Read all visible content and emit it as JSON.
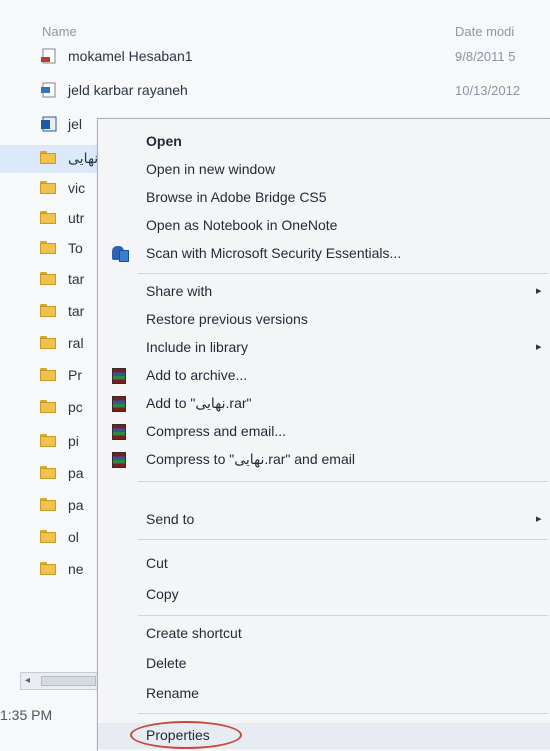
{
  "header": {
    "name_col": "Name",
    "date_col": "Date modi"
  },
  "files": [
    {
      "name": "mokamel Hesaban1",
      "date": "9/8/2011 5",
      "icon": "file-icon"
    },
    {
      "name": "jeld karbar rayaneh",
      "date": "10/13/2012",
      "icon": "file-icon"
    },
    {
      "name": "jel",
      "date": "",
      "icon": "publisher-file-icon"
    },
    {
      "name": "نهایی",
      "date": "",
      "icon": "folder-icon"
    },
    {
      "name": "vic",
      "date": "",
      "icon": "folder-icon"
    },
    {
      "name": "utr",
      "date": "",
      "icon": "folder-icon"
    },
    {
      "name": "To",
      "date": "",
      "icon": "folder-icon"
    },
    {
      "name": "tar",
      "date": "",
      "icon": "folder-icon"
    },
    {
      "name": "tar",
      "date": "",
      "icon": "folder-icon"
    },
    {
      "name": "ral",
      "date": "",
      "icon": "folder-icon"
    },
    {
      "name": "Pr",
      "date": "",
      "icon": "folder-icon"
    },
    {
      "name": "pc",
      "date": "",
      "icon": "folder-icon"
    },
    {
      "name": "pi",
      "date": "",
      "icon": "folder-icon"
    },
    {
      "name": "pa",
      "date": "",
      "icon": "folder-icon"
    },
    {
      "name": "pa",
      "date": "",
      "icon": "folder-icon"
    },
    {
      "name": "ol",
      "date": "",
      "icon": "folder-icon"
    },
    {
      "name": "ne",
      "date": "",
      "icon": "folder-icon"
    }
  ],
  "status": {
    "time": "1:35 PM"
  },
  "menu": {
    "open": "Open",
    "open_new_window": "Open in new window",
    "browse_bridge": "Browse in Adobe Bridge CS5",
    "open_onenote": "Open as Notebook in OneNote",
    "scan_security": "Scan with Microsoft Security Essentials...",
    "share_with": "Share with",
    "restore_versions": "Restore previous versions",
    "include_library": "Include in library",
    "add_archive": "Add to archive...",
    "add_to_rar": "Add to \"نهایی.rar\"",
    "compress_email": "Compress and email...",
    "compress_rar_email": "Compress to \"نهایی.rar\" and email",
    "send_to": "Send to",
    "cut": "Cut",
    "copy": "Copy",
    "create_shortcut": "Create shortcut",
    "delete": "Delete",
    "rename": "Rename",
    "properties": "Properties",
    "submenu_arrow": "▸"
  },
  "colors": {
    "highlight_oval": "#c44a3a",
    "folder": "#f0c14b",
    "selection": "#dbe9fb"
  }
}
